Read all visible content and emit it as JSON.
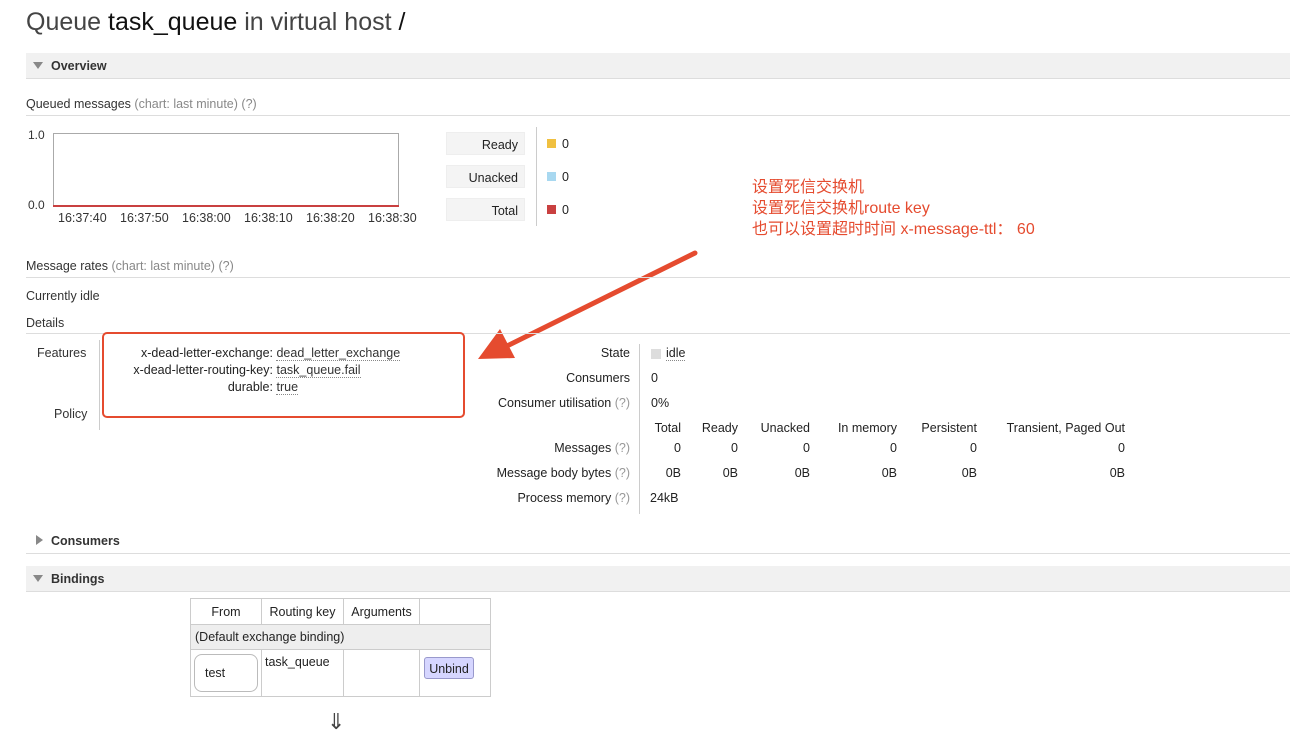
{
  "title": {
    "prefix": "Queue",
    "queue": "task_queue",
    "middle": "in virtual host",
    "vhost": "/"
  },
  "sections": {
    "overview": "Overview",
    "consumers": "Consumers",
    "bindings": "Bindings"
  },
  "queued_messages": {
    "label": "Queued messages",
    "chart_hint": "(chart: last minute)",
    "help": "(?)",
    "legend": [
      {
        "label": "Ready",
        "value": "0",
        "color": "#f0c040"
      },
      {
        "label": "Unacked",
        "value": "0",
        "color": "#a8d8f0"
      },
      {
        "label": "Total",
        "value": "0",
        "color": "#c94040"
      }
    ]
  },
  "chart_data": {
    "type": "line",
    "x": [
      "16:37:40",
      "16:37:50",
      "16:38:00",
      "16:38:10",
      "16:38:20",
      "16:38:30"
    ],
    "yticks": [
      "1.0",
      "0.0"
    ],
    "ylim": [
      0,
      1
    ],
    "series": [
      {
        "name": "Ready",
        "values": [
          0,
          0,
          0,
          0,
          0,
          0
        ]
      },
      {
        "name": "Unacked",
        "values": [
          0,
          0,
          0,
          0,
          0,
          0
        ]
      },
      {
        "name": "Total",
        "values": [
          0,
          0,
          0,
          0,
          0,
          0
        ]
      }
    ]
  },
  "message_rates": {
    "label": "Message rates",
    "chart_hint": "(chart: last minute)",
    "help": "(?)",
    "status": "Currently idle"
  },
  "details": {
    "label": "Details",
    "features_label": "Features",
    "policy_label": "Policy",
    "features": [
      {
        "key": "x-dead-letter-exchange:",
        "value": "dead_letter_exchange"
      },
      {
        "key": "x-dead-letter-routing-key:",
        "value": "task_queue.fail"
      },
      {
        "key": "durable:",
        "value": "true"
      }
    ],
    "state_label": "State",
    "state_value": "idle",
    "consumers_label": "Consumers",
    "consumers_value": "0",
    "utilisation_label": "Consumer utilisation",
    "utilisation_value": "0%",
    "help": "(?)",
    "stats_headers": [
      "Total",
      "Ready",
      "Unacked",
      "In memory",
      "Persistent",
      "Transient, Paged Out"
    ],
    "messages_label": "Messages",
    "messages_values": [
      "0",
      "0",
      "0",
      "0",
      "0",
      "0"
    ],
    "body_bytes_label": "Message body bytes",
    "body_bytes_values": [
      "0B",
      "0B",
      "0B",
      "0B",
      "0B",
      "0B"
    ],
    "process_memory_label": "Process memory",
    "process_memory_value": "24kB"
  },
  "annotation": {
    "line1": "设置死信交换机",
    "line2": "设置死信交换机route key",
    "line3": "也可以设置超时时间 x-message-ttl： 60",
    "color": "#e54b2f"
  },
  "bindings": {
    "headers": [
      "From",
      "Routing key",
      "Arguments"
    ],
    "default_row": "(Default exchange binding)",
    "from": "test",
    "routing_key": "task_queue",
    "arguments": "",
    "unbind_label": "Unbind",
    "arrow_glyph": "⇓"
  }
}
